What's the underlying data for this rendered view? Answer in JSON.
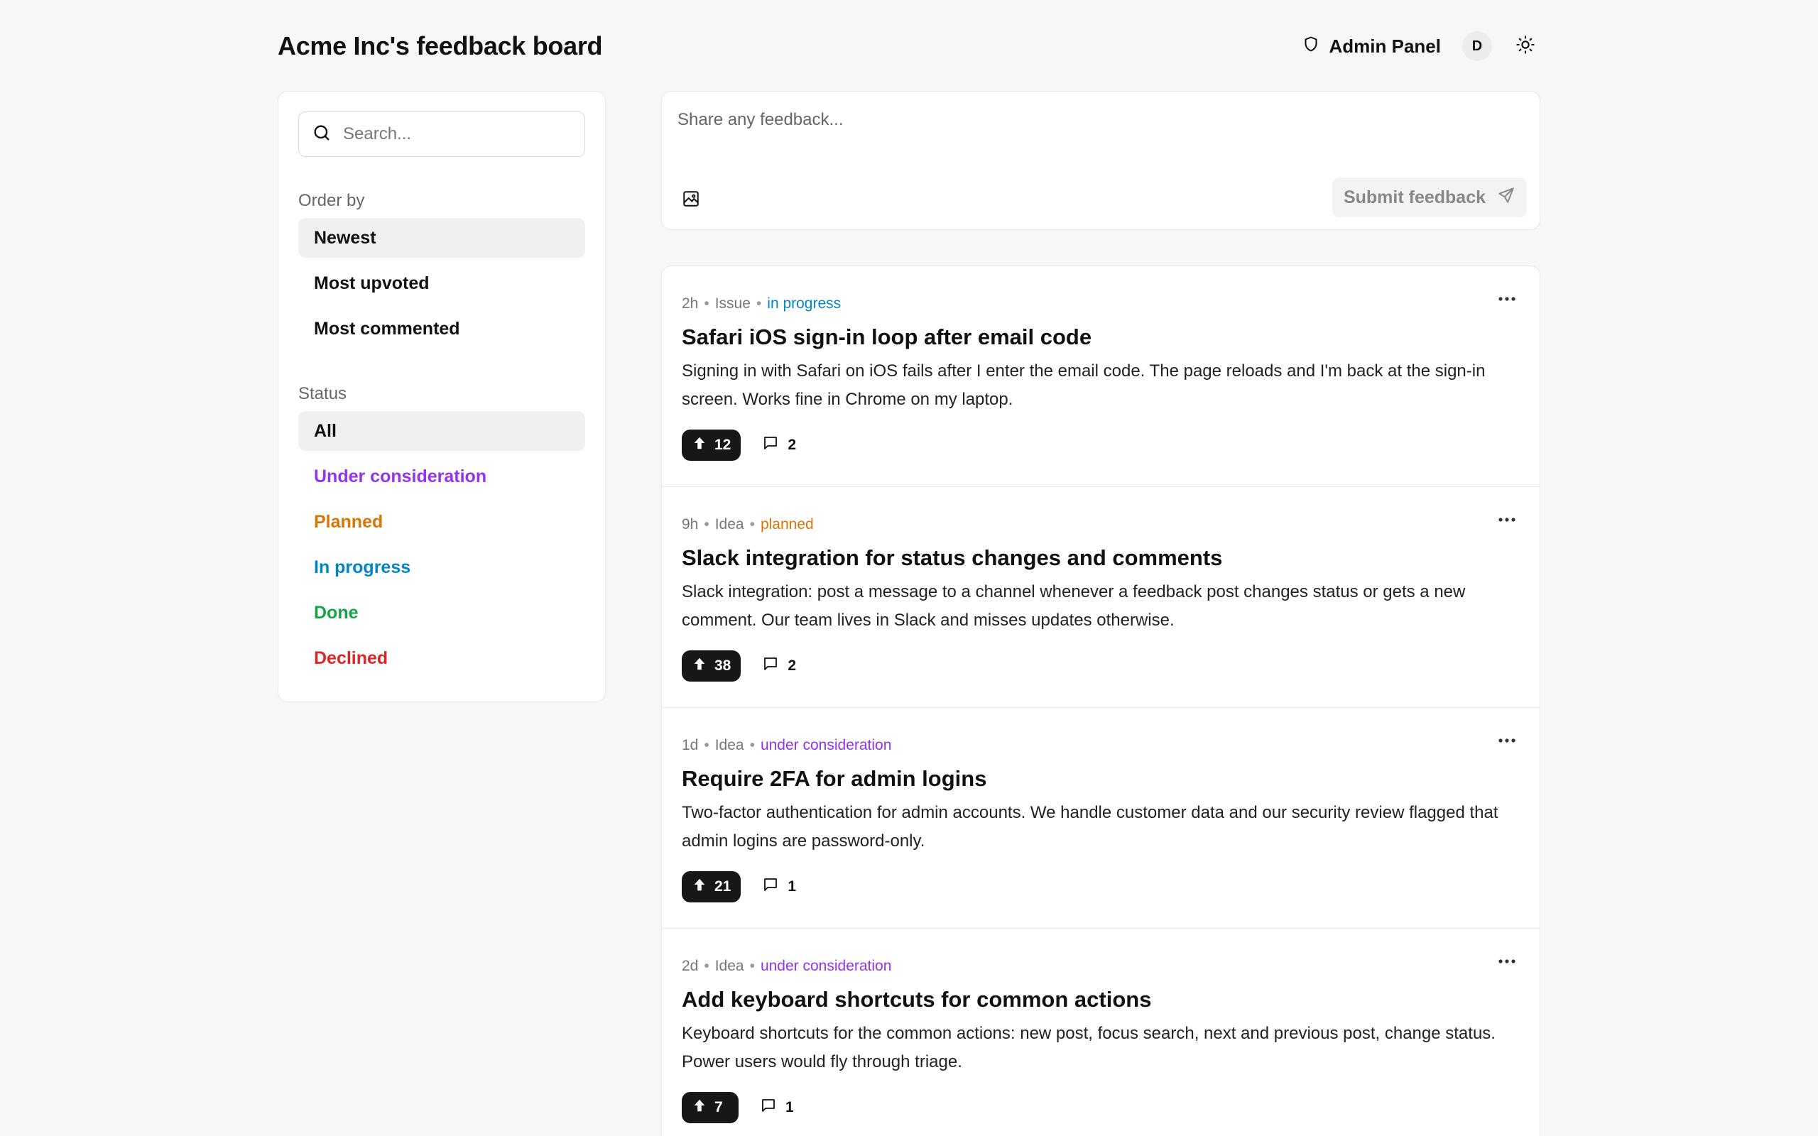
{
  "header": {
    "title": "Acme Inc's feedback board",
    "admin_label": "Admin Panel",
    "avatar_initial": "D"
  },
  "sidebar": {
    "search_placeholder": "Search...",
    "order_title": "Order by",
    "order_items": [
      {
        "label": "Newest",
        "active": true
      },
      {
        "label": "Most upvoted",
        "active": false
      },
      {
        "label": "Most commented",
        "active": false
      }
    ],
    "status_title": "Status",
    "status_items": [
      {
        "label": "All",
        "color": "#111111",
        "active": true
      },
      {
        "label": "Under consideration",
        "color": "#9333ea",
        "active": false
      },
      {
        "label": "Planned",
        "color": "#d97706",
        "active": false
      },
      {
        "label": "In progress",
        "color": "#0284c7",
        "active": false
      },
      {
        "label": "Done",
        "color": "#16a34a",
        "active": false
      },
      {
        "label": "Declined",
        "color": "#dc2626",
        "active": false
      }
    ]
  },
  "composer": {
    "placeholder": "Share any feedback...",
    "submit_label": "Submit feedback"
  },
  "posts": [
    {
      "time": "2h",
      "type": "Issue",
      "status": "in progress",
      "status_color": "#0284c7",
      "title": "Safari iOS sign-in loop after email code",
      "body": "Signing in with Safari on iOS fails after I enter the email code. The page reloads and I'm back at the sign-in screen. Works fine in Chrome on my laptop.",
      "upvotes": "12",
      "comments": "2"
    },
    {
      "time": "9h",
      "type": "Idea",
      "status": "planned",
      "status_color": "#d97706",
      "title": "Slack integration for status changes and comments",
      "body": "Slack integration: post a message to a channel whenever a feedback post changes status or gets a new comment. Our team lives in Slack and misses updates otherwise.",
      "upvotes": "38",
      "comments": "2"
    },
    {
      "time": "1d",
      "type": "Idea",
      "status": "under consideration",
      "status_color": "#9333ea",
      "title": "Require 2FA for admin logins",
      "body": "Two-factor authentication for admin accounts. We handle customer data and our security review flagged that admin logins are password-only.",
      "upvotes": "21",
      "comments": "1"
    },
    {
      "time": "2d",
      "type": "Idea",
      "status": "under consideration",
      "status_color": "#9333ea",
      "title": "Add keyboard shortcuts for common actions",
      "body": "Keyboard shortcuts for the common actions: new post, focus search, next and previous post, change status. Power users would fly through triage.",
      "upvotes": "7",
      "comments": "1"
    }
  ],
  "icons": {
    "admin": "shield-icon",
    "theme": "sun-icon",
    "search": "search-icon",
    "attach": "image-icon",
    "submit": "send-icon",
    "upvote": "arrow-up-icon",
    "comment": "message-square-icon",
    "more": "more-horizontal-icon"
  }
}
